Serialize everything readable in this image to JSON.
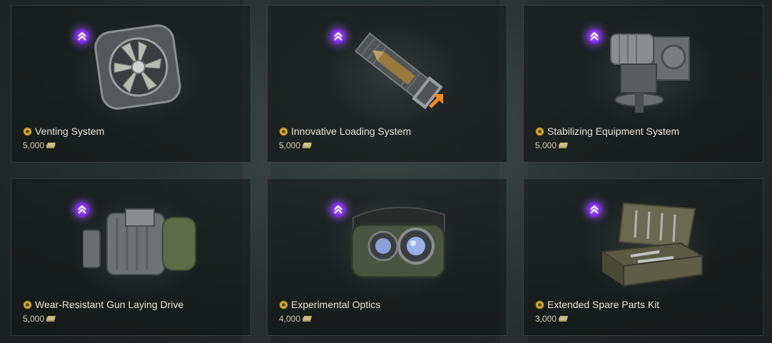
{
  "cards": [
    {
      "name": "Venting System",
      "price": "5,000",
      "icon": "fan-icon"
    },
    {
      "name": "Innovative Loading System",
      "price": "5,000",
      "icon": "shell-loader-icon"
    },
    {
      "name": "Stabilizing Equipment System",
      "price": "5,000",
      "icon": "motor-gear-icon"
    },
    {
      "name": "Wear-Resistant Gun Laying Drive",
      "price": "5,000",
      "icon": "electric-motor-icon"
    },
    {
      "name": "Experimental Optics",
      "price": "4,000",
      "icon": "binocular-optics-icon"
    },
    {
      "name": "Extended Spare Parts Kit",
      "price": "3,000",
      "icon": "toolbox-icon"
    }
  ],
  "colors": {
    "badge": "#8a3cf0",
    "text": "#e8e4d8",
    "gold": "#e0b030",
    "credits": "#a89a60"
  }
}
